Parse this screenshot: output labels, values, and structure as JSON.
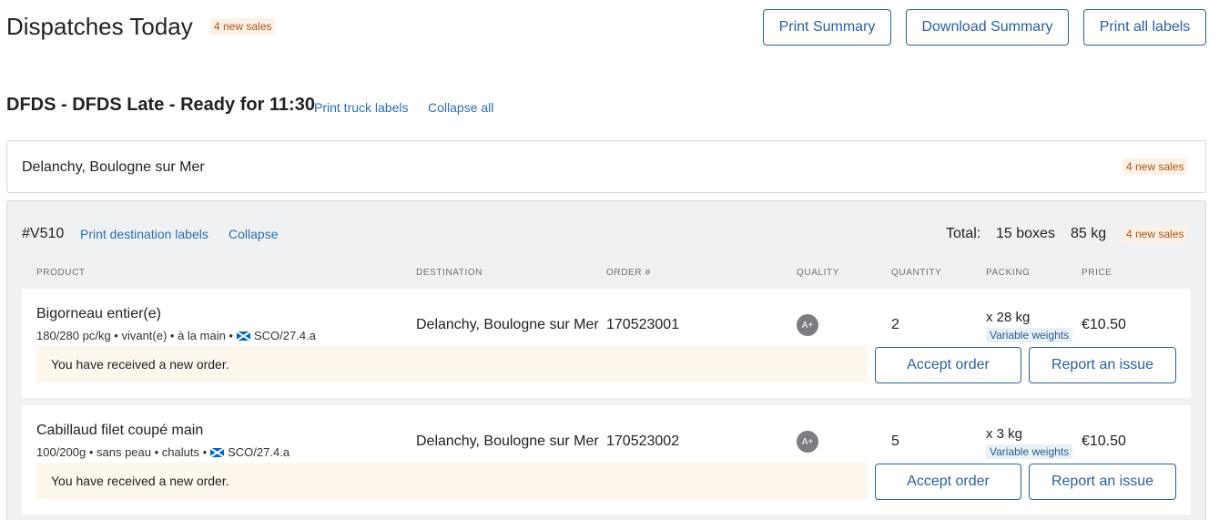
{
  "header": {
    "title": "Dispatches Today",
    "badge": "4 new sales",
    "buttons": {
      "print_summary": "Print Summary",
      "download_summary": "Download Summary",
      "print_all_labels": "Print all labels"
    }
  },
  "group": {
    "title": "DFDS - DFDS Late - Ready for 11:30",
    "print_truck_labels": "Print truck labels",
    "collapse_all": "Collapse all"
  },
  "destination": {
    "name": "Delanchy, Boulogne sur Mer",
    "badge": "4 new sales"
  },
  "order": {
    "id": "#V510",
    "print_destination_labels": "Print destination labels",
    "collapse": "Collapse",
    "total_label": "Total:",
    "total_boxes": "15 boxes",
    "total_kg": "85 kg",
    "badge": "4 new sales"
  },
  "columns": {
    "product": "PRODUCT",
    "destination": "DESTINATION",
    "order_no": "ORDER #",
    "quality": "QUALITY",
    "quantity": "QUANTITY",
    "packing": "PACKING",
    "price": "PRICE"
  },
  "rows": [
    {
      "product": "Bigorneau entier(e)",
      "meta_text": "180/280 pc/kg • vivant(e) • à la main •",
      "meta_origin": "SCO/27.4.a",
      "flag_icon": "scotland-flag-icon",
      "destination": "Delanchy, Boulogne sur Mer",
      "order_no": "170523001",
      "quality": "A+",
      "quantity": "2",
      "packing": "x 28 kg",
      "packing_note": "Variable weights",
      "price": "€10.50",
      "notice": "You have received a new order.",
      "accept": "Accept order",
      "report": "Report an issue"
    },
    {
      "product": "Cabillaud filet coupé main",
      "meta_text": "100/200g • sans peau • chaluts •",
      "meta_origin": "SCO/27.4.a",
      "flag_icon": "scotland-flag-icon",
      "destination": "Delanchy, Boulogne sur Mer",
      "order_no": "170523002",
      "quality": "A+",
      "quantity": "5",
      "packing": "x 3 kg",
      "packing_note": "Variable weights",
      "price": "€10.50",
      "notice": "You have received a new order.",
      "accept": "Accept order",
      "report": "Report an issue"
    }
  ],
  "colors": {
    "accent": "#2c5f9e",
    "link": "#2c6db0",
    "badge_text": "#a6541e",
    "badge_bg": "#fdf1e6",
    "notice_bg": "#fdf7ee",
    "panel_bg": "#f0f1f3"
  }
}
